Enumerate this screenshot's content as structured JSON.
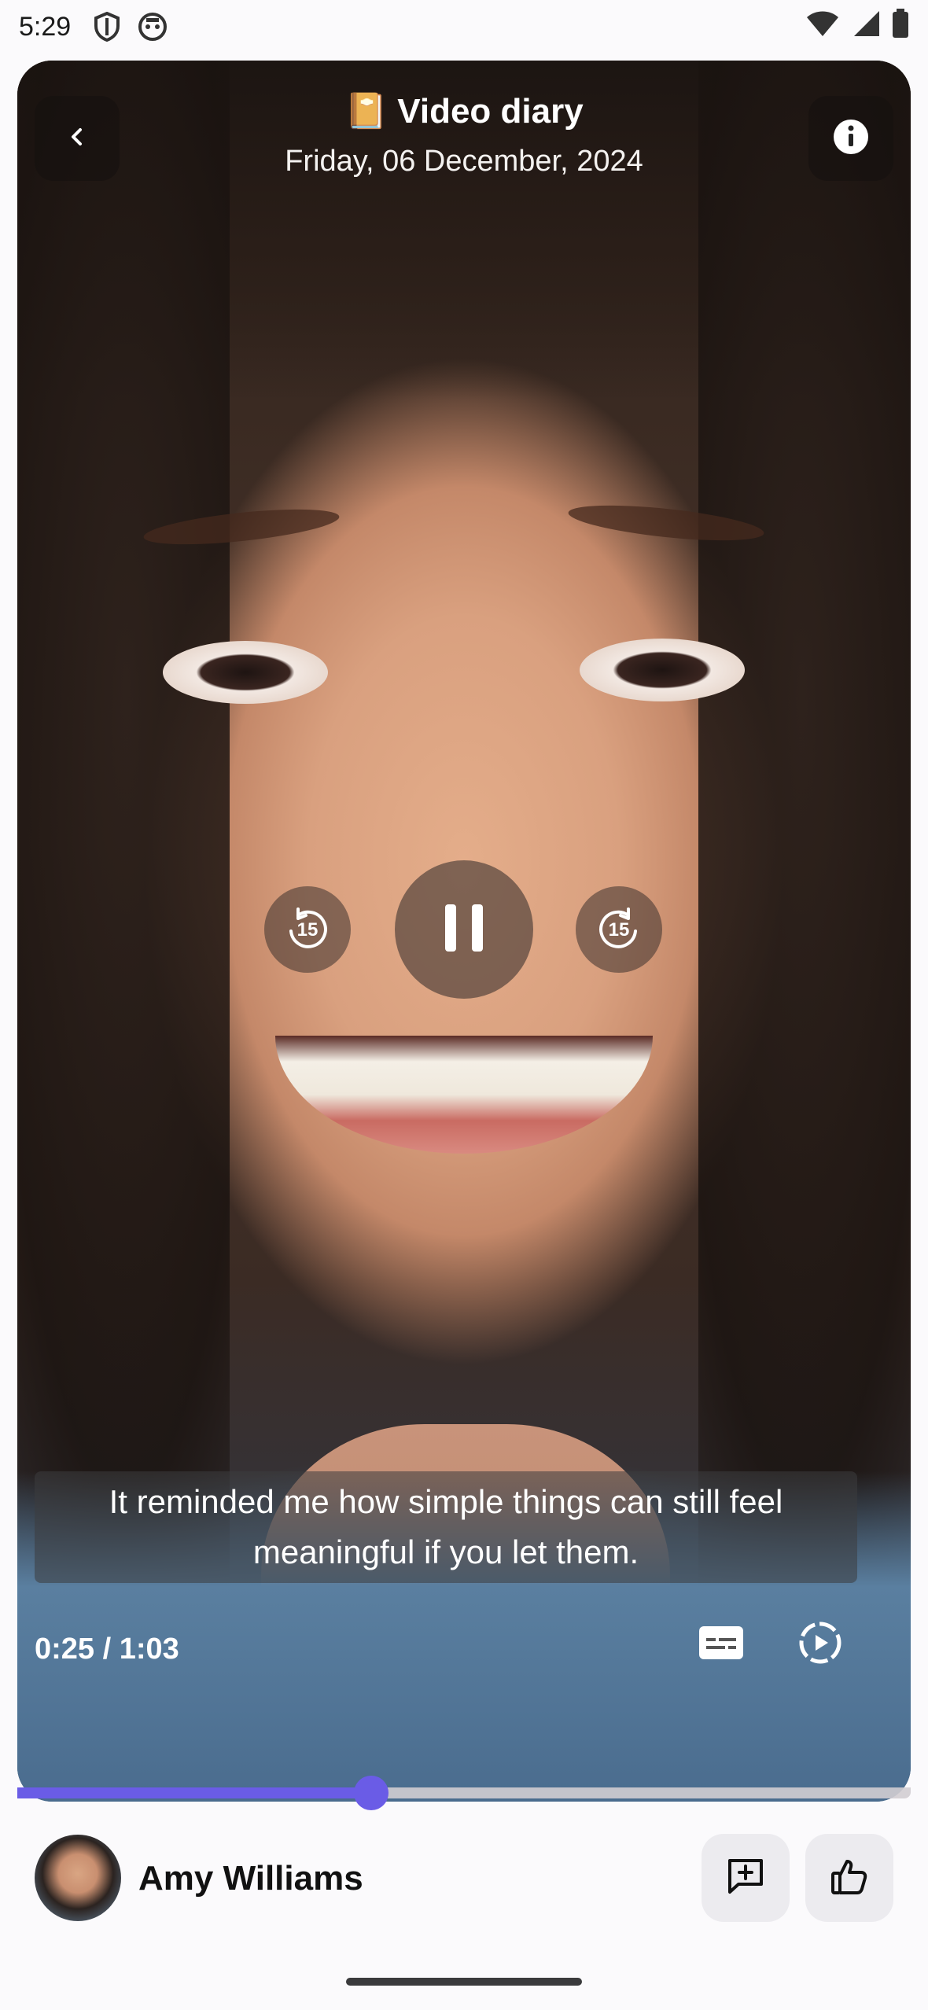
{
  "status_bar": {
    "time": "5:29"
  },
  "header": {
    "title": "📔 Video diary",
    "date": "Friday, 06 December, 2024"
  },
  "player": {
    "caption": "It reminded me how simple things can still feel meaningful if you let them.",
    "timecode": "0:25 / 1:03",
    "progress": 0.396,
    "skip_back_seconds": "15",
    "skip_forward_seconds": "15",
    "accent_color": "#6a5ce6"
  },
  "author": {
    "name": "Amy Williams"
  },
  "icons": {
    "back": "chevron-left-icon",
    "info": "info-icon",
    "rewind": "rewind-15-icon",
    "pause": "pause-icon",
    "forward": "forward-15-icon",
    "captions": "captions-icon",
    "autoplay": "autoplay-icon",
    "comment": "add-comment-icon",
    "like": "thumbs-up-icon"
  }
}
